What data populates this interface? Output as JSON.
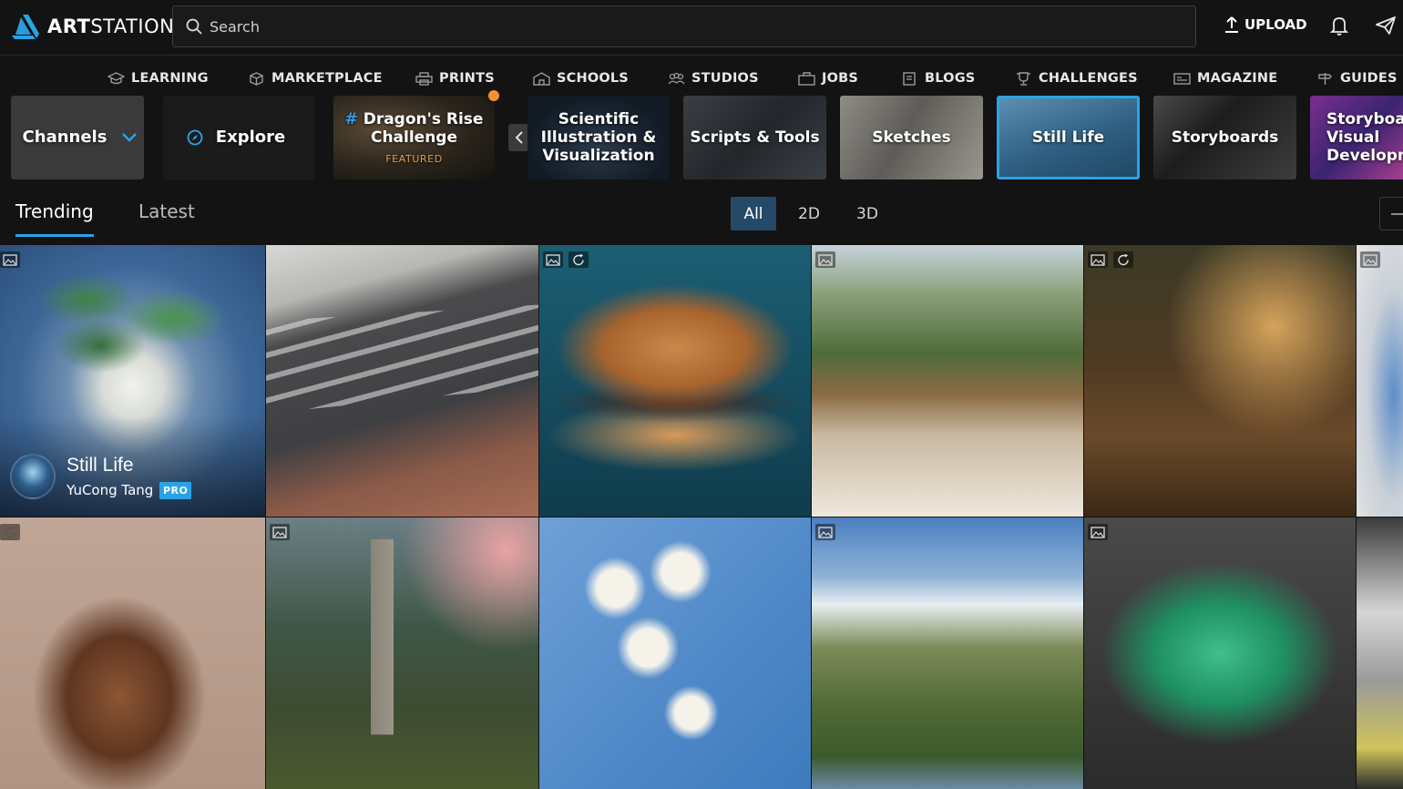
{
  "brand": {
    "logo_bold": "ART",
    "logo_light": "STATION"
  },
  "search": {
    "placeholder": "Search"
  },
  "header": {
    "upload_label": "UPLOAD"
  },
  "subnav": [
    "LEARNING",
    "MARKETPLACE",
    "PRINTS",
    "SCHOOLS",
    "STUDIOS",
    "JOBS",
    "BLOGS",
    "CHALLENGES",
    "MAGAZINE",
    "GUIDES"
  ],
  "channels": {
    "button_label": "Channels",
    "explore_label": "Explore",
    "featured": {
      "hash": "#",
      "title": "Dragon's Rise Challenge",
      "tag": "FEATURED"
    },
    "items": [
      {
        "label": "Scientific Illustration & Visualization"
      },
      {
        "label": "Scripts & Tools"
      },
      {
        "label": "Sketches"
      },
      {
        "label": "Still Life",
        "selected": true
      },
      {
        "label": "Storyboards"
      },
      {
        "label": "Storyboards Visual Development"
      }
    ]
  },
  "tabs": {
    "trending": "Trending",
    "latest": "Latest"
  },
  "filters": {
    "all": "All",
    "2d": "2D",
    "3d": "3D",
    "selected": "All"
  },
  "featured_art": {
    "title": "Still Life",
    "author": "YuCong Tang",
    "badge": "PRO"
  },
  "colors": {
    "accent": "#2aa3e6",
    "featured_dot": "#f5922b",
    "filter_active": "#254a68"
  },
  "icons": [
    "artstation-logo-icon",
    "search-icon",
    "upload-icon",
    "bell-icon",
    "paper-plane-icon",
    "image-icon",
    "rotate-3d-icon",
    "compass-icon",
    "chevron-down-icon",
    "chevron-left-icon"
  ]
}
